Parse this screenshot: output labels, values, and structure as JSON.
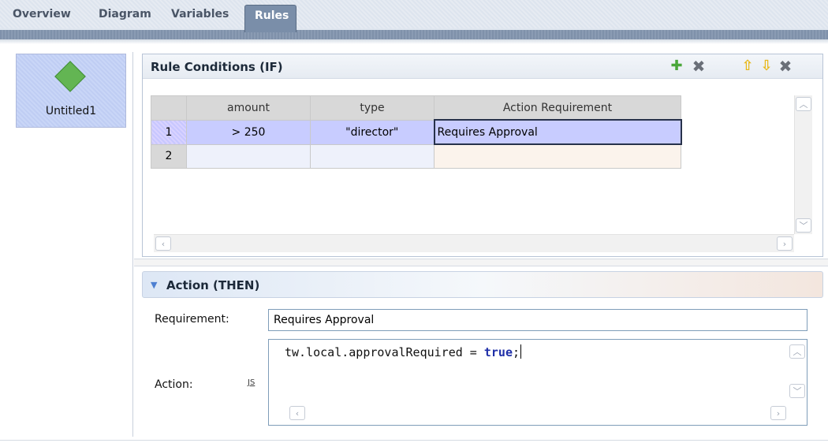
{
  "tabs": [
    "Overview",
    "Diagram",
    "Variables",
    "Rules"
  ],
  "active_tab": "Rules",
  "rules_list": [
    {
      "name": "Untitled1",
      "icon": "green-diamond-icon"
    }
  ],
  "conditions": {
    "title": "Rule Conditions (IF)",
    "toolbar": [
      "add-icon",
      "delete-icon",
      "move-up-icon",
      "move-down-icon",
      "remove-icon"
    ],
    "columns": [
      "amount",
      "type",
      "Action Requirement"
    ],
    "rows": [
      {
        "num": "1",
        "amount": "> 250",
        "type": "\"director\"",
        "requirement": "Requires Approval"
      },
      {
        "num": "2",
        "amount": "",
        "type": "",
        "requirement": ""
      }
    ]
  },
  "action": {
    "title": "Action (THEN)",
    "requirement_label": "Requirement:",
    "requirement_value": "Requires Approval",
    "action_label": "Action:",
    "js_badge": "JS",
    "code_plain": "tw.local.approvalRequired = ",
    "code_keyword": "true",
    "code_end": ";"
  },
  "colors": {
    "accent": "#7a8ea9",
    "selection": "#c8ccff",
    "diamond": "#63b553"
  }
}
